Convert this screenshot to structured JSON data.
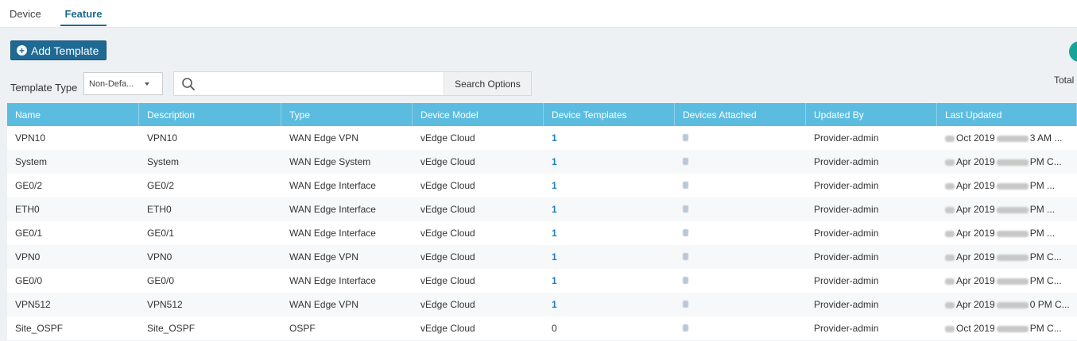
{
  "tabs": [
    {
      "label": "Device",
      "active": false
    },
    {
      "label": "Feature",
      "active": true
    }
  ],
  "toolbar": {
    "add_label": "Add Template",
    "template_type_label": "Template Type",
    "template_type_value": "Non-Defa...",
    "search_placeholder": "",
    "search_value": "",
    "search_options_label": "Search Options",
    "total_label": "Total"
  },
  "colors": {
    "accent": "#1f6a94",
    "header_bg": "#5bbce0",
    "link": "#1a7fc2",
    "teal": "#17a59a"
  },
  "table": {
    "headers": [
      "Name",
      "Description",
      "Type",
      "Device Model",
      "Device Templates",
      "Devices Attached",
      "Updated By",
      "Last Updated"
    ],
    "rows": [
      {
        "name": "VPN10",
        "description": "VPN10",
        "type": "WAN Edge VPN",
        "model": "vEdge Cloud",
        "templates": "1",
        "updated_by": "Provider-admin",
        "last_pre": "",
        "last_mid": "Oct 2019",
        "last_post": "3 AM ..."
      },
      {
        "name": "System",
        "description": "System",
        "type": "WAN Edge System",
        "model": "vEdge Cloud",
        "templates": "1",
        "updated_by": "Provider-admin",
        "last_pre": "",
        "last_mid": "Apr 2019",
        "last_post": "PM C..."
      },
      {
        "name": "GE0/2",
        "description": "GE0/2",
        "type": "WAN Edge Interface",
        "model": "vEdge Cloud",
        "templates": "1",
        "updated_by": "Provider-admin",
        "last_pre": "",
        "last_mid": "Apr 2019",
        "last_post": "PM ..."
      },
      {
        "name": "ETH0",
        "description": "ETH0",
        "type": "WAN Edge Interface",
        "model": "vEdge Cloud",
        "templates": "1",
        "updated_by": "Provider-admin",
        "last_pre": "",
        "last_mid": "Apr 2019",
        "last_post": "PM ..."
      },
      {
        "name": "GE0/1",
        "description": "GE0/1",
        "type": "WAN Edge Interface",
        "model": "vEdge Cloud",
        "templates": "1",
        "updated_by": "Provider-admin",
        "last_pre": "",
        "last_mid": "Apr 2019",
        "last_post": "PM ..."
      },
      {
        "name": "VPN0",
        "description": "VPN0",
        "type": "WAN Edge VPN",
        "model": "vEdge Cloud",
        "templates": "1",
        "updated_by": "Provider-admin",
        "last_pre": "",
        "last_mid": "Apr 2019",
        "last_post": "PM C..."
      },
      {
        "name": "GE0/0",
        "description": "GE0/0",
        "type": "WAN Edge Interface",
        "model": "vEdge Cloud",
        "templates": "1",
        "updated_by": "Provider-admin",
        "last_pre": "",
        "last_mid": "Apr 2019",
        "last_post": "PM C..."
      },
      {
        "name": "VPN512",
        "description": "VPN512",
        "type": "WAN Edge VPN",
        "model": "vEdge Cloud",
        "templates": "1",
        "updated_by": "Provider-admin",
        "last_pre": "",
        "last_mid": "Apr 2019",
        "last_post": "0 PM C..."
      },
      {
        "name": "Site_OSPF",
        "description": "Site_OSPF",
        "type": "OSPF",
        "model": "vEdge Cloud",
        "templates": "0",
        "updated_by": "Provider-admin",
        "last_pre": "",
        "last_mid": "Oct 2019",
        "last_post": "PM C..."
      }
    ]
  }
}
